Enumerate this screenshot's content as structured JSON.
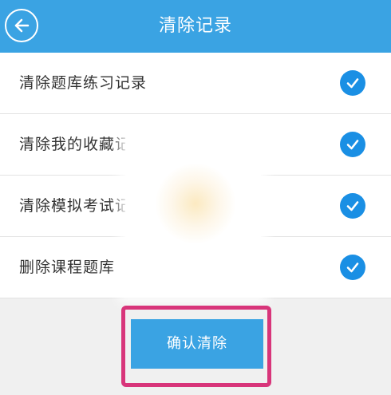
{
  "header": {
    "title": "清除记录",
    "back_icon": "back-arrow-circle-icon",
    "background_color": "#3aa3e3"
  },
  "options": [
    {
      "label": "清除题库练习记录",
      "checked": true
    },
    {
      "label": "清除我的收藏记录",
      "checked": true
    },
    {
      "label": "清除模拟考试记录",
      "checked": true
    },
    {
      "label": "删除课程题库",
      "checked": true
    }
  ],
  "confirm": {
    "label": "确认清除",
    "highlight_color": "#d8357a"
  },
  "check_icon": "check-circle-icon",
  "accent_color": "#1a8fe4"
}
